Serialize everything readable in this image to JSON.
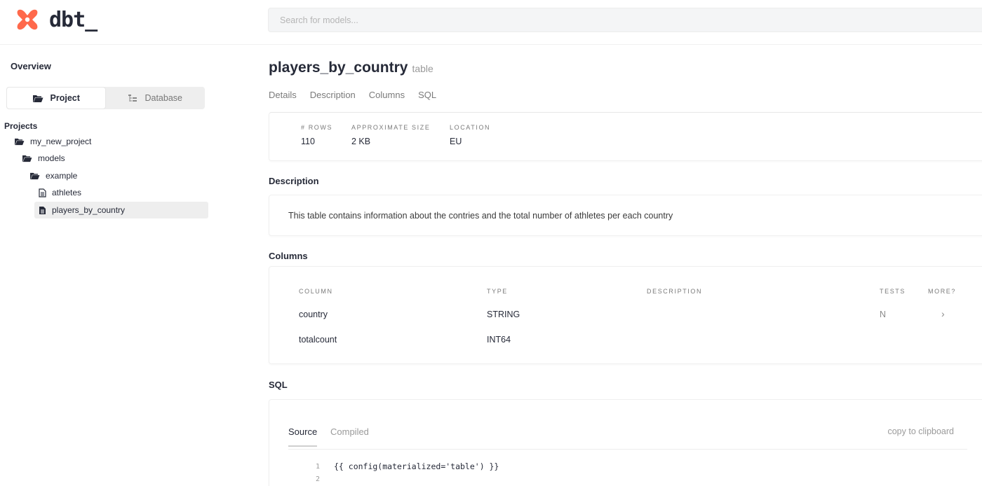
{
  "app": {
    "logo_text": "dbt_",
    "accent": "#262a38",
    "logo_color": "#ff694b"
  },
  "search": {
    "placeholder": "Search for models..."
  },
  "sidebar": {
    "overview": "Overview",
    "segments": [
      {
        "label": "Project",
        "icon": "folder-open-icon",
        "active": true
      },
      {
        "label": "Database",
        "icon": "tree-icon",
        "active": false
      }
    ],
    "projects_label": "Projects",
    "tree": [
      {
        "label": "my_new_project",
        "icon": "folder-open-icon",
        "depth": 0
      },
      {
        "label": "models",
        "icon": "folder-open-icon",
        "depth": 1
      },
      {
        "label": "example",
        "icon": "folder-open-icon",
        "depth": 2
      },
      {
        "label": "athletes",
        "icon": "file-icon",
        "depth": 3
      },
      {
        "label": "players_by_country",
        "icon": "file-icon",
        "depth": 3,
        "selected": true
      }
    ]
  },
  "model": {
    "name": "players_by_country",
    "type": "table",
    "tabs": [
      "Details",
      "Description",
      "Columns",
      "SQL"
    ],
    "stats": [
      {
        "label": "# ROWS",
        "value": "110"
      },
      {
        "label": "APPROXIMATE SIZE",
        "value": "2 KB"
      },
      {
        "label": "LOCATION",
        "value": "EU"
      }
    ],
    "description_heading": "Description",
    "description": "This table contains information about the contries and the total number of athletes per each country",
    "columns_heading": "Columns",
    "columns_headers": [
      "COLUMN",
      "TYPE",
      "DESCRIPTION",
      "TESTS",
      "MORE?"
    ],
    "columns_rows": [
      {
        "column": "country",
        "type": "STRING",
        "description": "",
        "tests": "N",
        "more": "›"
      },
      {
        "column": "totalcount",
        "type": "INT64",
        "description": "",
        "tests": "",
        "more": ""
      }
    ],
    "sql_heading": "SQL",
    "sql_tabs": [
      "Source",
      "Compiled"
    ],
    "copy_label": "copy to clipboard",
    "code_lines": [
      {
        "no": "1",
        "text": "{{ config(materialized='table') }}"
      },
      {
        "no": "2",
        "text": ""
      }
    ]
  }
}
